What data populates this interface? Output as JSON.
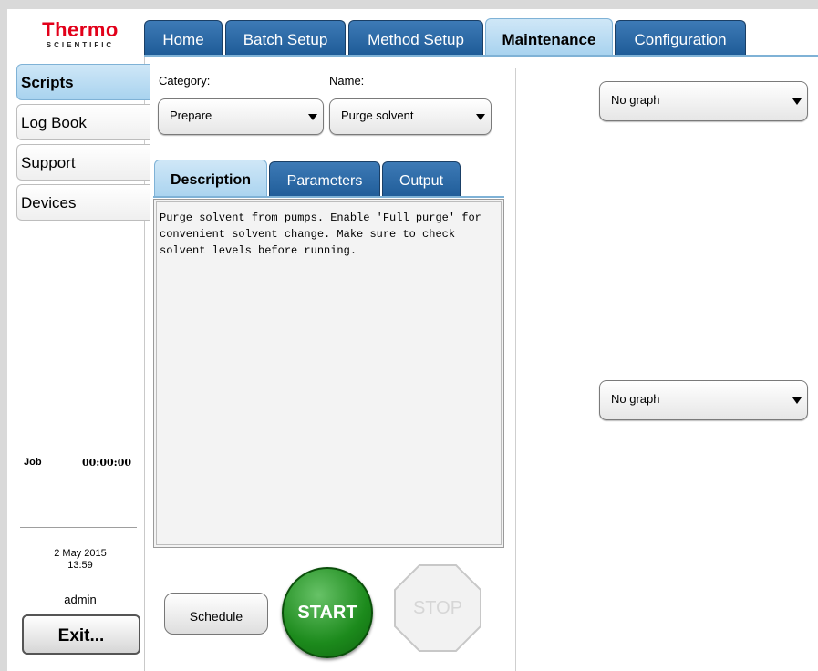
{
  "logo": {
    "main": "Thermo",
    "sub": "SCIENTIFIC"
  },
  "tabs": [
    {
      "label": "Home",
      "active": false
    },
    {
      "label": "Batch Setup",
      "active": false
    },
    {
      "label": "Method Setup",
      "active": false
    },
    {
      "label": "Maintenance",
      "active": true
    },
    {
      "label": "Configuration",
      "active": false
    }
  ],
  "sidebar": {
    "items": [
      {
        "label": "Scripts",
        "active": true
      },
      {
        "label": "Log Book",
        "active": false
      },
      {
        "label": "Support",
        "active": false
      },
      {
        "label": "Devices",
        "active": false
      }
    ],
    "job_label": "Job",
    "job_time": "00:00:00",
    "date": "2 May 2015",
    "time": "13:59",
    "user": "admin",
    "exit_label": "Exit..."
  },
  "main": {
    "category_label": "Category:",
    "category_value": "Prepare",
    "name_label": "Name:",
    "name_value": "Purge solvent",
    "subtabs": [
      {
        "label": "Description",
        "active": true
      },
      {
        "label": "Parameters",
        "active": false
      },
      {
        "label": "Output",
        "active": false
      }
    ],
    "description": "Purge solvent from pumps. Enable 'Full purge' for convenient solvent change. Make sure to check solvent levels before running.",
    "schedule_label": "Schedule",
    "start_label": "START",
    "stop_label": "STOP"
  },
  "graphs": {
    "top_value": "No graph",
    "bottom_value": "No graph"
  },
  "colors": {
    "brand_red": "#e2001a",
    "tab_blue": "#1f5c98",
    "tab_active": "#a9d3ef",
    "start_green": "#1c8a1c"
  }
}
